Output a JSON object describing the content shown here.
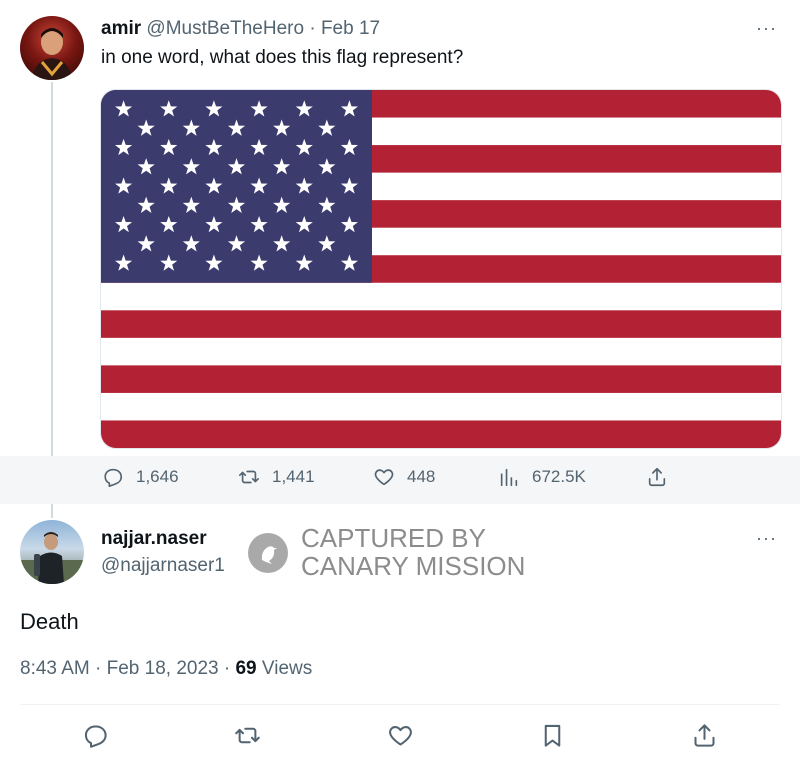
{
  "tweet": {
    "author_name": "amir",
    "author_handle": "@MustBeTheHero",
    "separator": "·",
    "date": "Feb 17",
    "text": "in one word, what does this flag represent?",
    "more_label": "···",
    "stats": {
      "replies": "1,646",
      "retweets": "1,441",
      "likes": "448",
      "views": "672.5K"
    },
    "flag_colors": {
      "red": "#b22234",
      "white": "#ffffff",
      "blue": "#3c3b6e"
    }
  },
  "reply": {
    "author_name": "najjar.naser",
    "author_handle": "@najjarnaser1",
    "more_label": "···",
    "text": "Death",
    "time": "8:43 AM",
    "separator": "·",
    "date": "Feb 18, 2023",
    "views_count": "69",
    "views_label": "Views"
  },
  "watermark": {
    "line1": "CAPTURED BY",
    "line2": "CANARY MISSION"
  },
  "colors": {
    "muted": "#536471",
    "divider": "#eff3f4",
    "band": "#f5f6f7"
  }
}
